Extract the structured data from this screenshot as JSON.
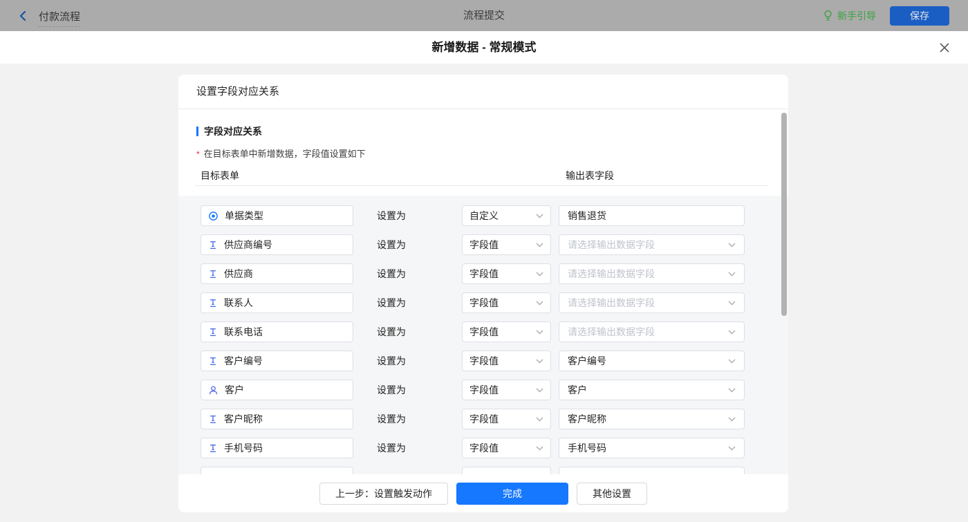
{
  "topbar": {
    "back_label": "付款流程",
    "center_title": "流程提交",
    "guide_label": "新手引导",
    "save_label": "保存"
  },
  "modal": {
    "title": "新增数据 - 常规模式"
  },
  "card": {
    "header": "设置字段对应关系",
    "section_title": "字段对应关系",
    "hint_mark": "*",
    "hint": "在目标表单中新增数据，字段值设置如下",
    "col_target": "目标表单",
    "col_output": "输出表字段",
    "set_as": "设置为"
  },
  "rows": [
    {
      "icon": "radio-icon",
      "field": "单据类型",
      "mode": "自定义",
      "output": "销售退货",
      "output_kind": "text-input"
    },
    {
      "icon": "text-field-icon",
      "field": "供应商编号",
      "mode": "字段值",
      "output": "请选择输出数据字段",
      "output_kind": "placeholder"
    },
    {
      "icon": "text-field-icon",
      "field": "供应商",
      "mode": "字段值",
      "output": "请选择输出数据字段",
      "output_kind": "placeholder"
    },
    {
      "icon": "text-field-icon",
      "field": "联系人",
      "mode": "字段值",
      "output": "请选择输出数据字段",
      "output_kind": "placeholder"
    },
    {
      "icon": "text-field-icon",
      "field": "联系电话",
      "mode": "字段值",
      "output": "请选择输出数据字段",
      "output_kind": "placeholder"
    },
    {
      "icon": "text-field-icon",
      "field": "客户编号",
      "mode": "字段值",
      "output": "客户编号",
      "output_kind": "value"
    },
    {
      "icon": "user-icon",
      "field": "客户",
      "mode": "字段值",
      "output": "客户",
      "output_kind": "value"
    },
    {
      "icon": "text-field-icon",
      "field": "客户昵称",
      "mode": "字段值",
      "output": "客户昵称",
      "output_kind": "value"
    },
    {
      "icon": "text-field-icon",
      "field": "手机号码",
      "mode": "字段值",
      "output": "手机号码",
      "output_kind": "value"
    },
    {
      "icon": "text-field-icon",
      "field": "",
      "mode": "",
      "output": "",
      "output_kind": "partial"
    }
  ],
  "footer": {
    "prev_label": "上一步：设置触发动作",
    "done_label": "完成",
    "other_label": "其他设置"
  },
  "colors": {
    "accent_blue": "#1677ff",
    "guide_green": "#3aa23d",
    "field_icon_blue": "#4569ef",
    "user_icon_indigo": "#5c6fe6",
    "required_red": "#f5222d",
    "topbar_dimmed": "#ababab"
  }
}
